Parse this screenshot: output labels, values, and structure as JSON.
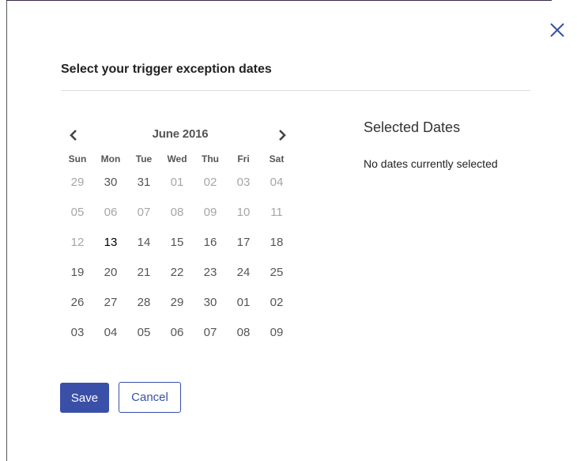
{
  "dialog": {
    "title": "Select your trigger exception dates",
    "close_icon": "close-icon"
  },
  "calendar": {
    "month_label": "June 2016",
    "prev_icon": "chevron-left-icon",
    "next_icon": "chevron-right-icon",
    "weekdays": [
      "Sun",
      "Mon",
      "Tue",
      "Wed",
      "Thu",
      "Fri",
      "Sat"
    ],
    "days": [
      {
        "label": "29",
        "state": "muted"
      },
      {
        "label": "30",
        "state": "normal"
      },
      {
        "label": "31",
        "state": "normal"
      },
      {
        "label": "01",
        "state": "muted"
      },
      {
        "label": "02",
        "state": "muted"
      },
      {
        "label": "03",
        "state": "muted"
      },
      {
        "label": "04",
        "state": "muted"
      },
      {
        "label": "05",
        "state": "muted"
      },
      {
        "label": "06",
        "state": "muted"
      },
      {
        "label": "07",
        "state": "muted"
      },
      {
        "label": "08",
        "state": "muted"
      },
      {
        "label": "09",
        "state": "muted"
      },
      {
        "label": "10",
        "state": "muted"
      },
      {
        "label": "11",
        "state": "muted"
      },
      {
        "label": "12",
        "state": "muted"
      },
      {
        "label": "13",
        "state": "today"
      },
      {
        "label": "14",
        "state": "normal"
      },
      {
        "label": "15",
        "state": "normal"
      },
      {
        "label": "16",
        "state": "normal"
      },
      {
        "label": "17",
        "state": "normal"
      },
      {
        "label": "18",
        "state": "normal"
      },
      {
        "label": "19",
        "state": "normal"
      },
      {
        "label": "20",
        "state": "normal"
      },
      {
        "label": "21",
        "state": "normal"
      },
      {
        "label": "22",
        "state": "normal"
      },
      {
        "label": "23",
        "state": "normal"
      },
      {
        "label": "24",
        "state": "normal"
      },
      {
        "label": "25",
        "state": "normal"
      },
      {
        "label": "26",
        "state": "normal"
      },
      {
        "label": "27",
        "state": "normal"
      },
      {
        "label": "28",
        "state": "normal"
      },
      {
        "label": "29",
        "state": "normal"
      },
      {
        "label": "30",
        "state": "normal"
      },
      {
        "label": "01",
        "state": "normal"
      },
      {
        "label": "02",
        "state": "normal"
      },
      {
        "label": "03",
        "state": "normal"
      },
      {
        "label": "04",
        "state": "normal"
      },
      {
        "label": "05",
        "state": "normal"
      },
      {
        "label": "06",
        "state": "normal"
      },
      {
        "label": "07",
        "state": "normal"
      },
      {
        "label": "08",
        "state": "normal"
      },
      {
        "label": "09",
        "state": "normal"
      }
    ]
  },
  "selected": {
    "title": "Selected Dates",
    "empty_text": "No dates currently selected"
  },
  "actions": {
    "save_label": "Save",
    "cancel_label": "Cancel"
  },
  "colors": {
    "accent": "#3a4fa8",
    "muted_day": "#a6a6a6",
    "normal_day": "#555555",
    "today": "#000000"
  }
}
